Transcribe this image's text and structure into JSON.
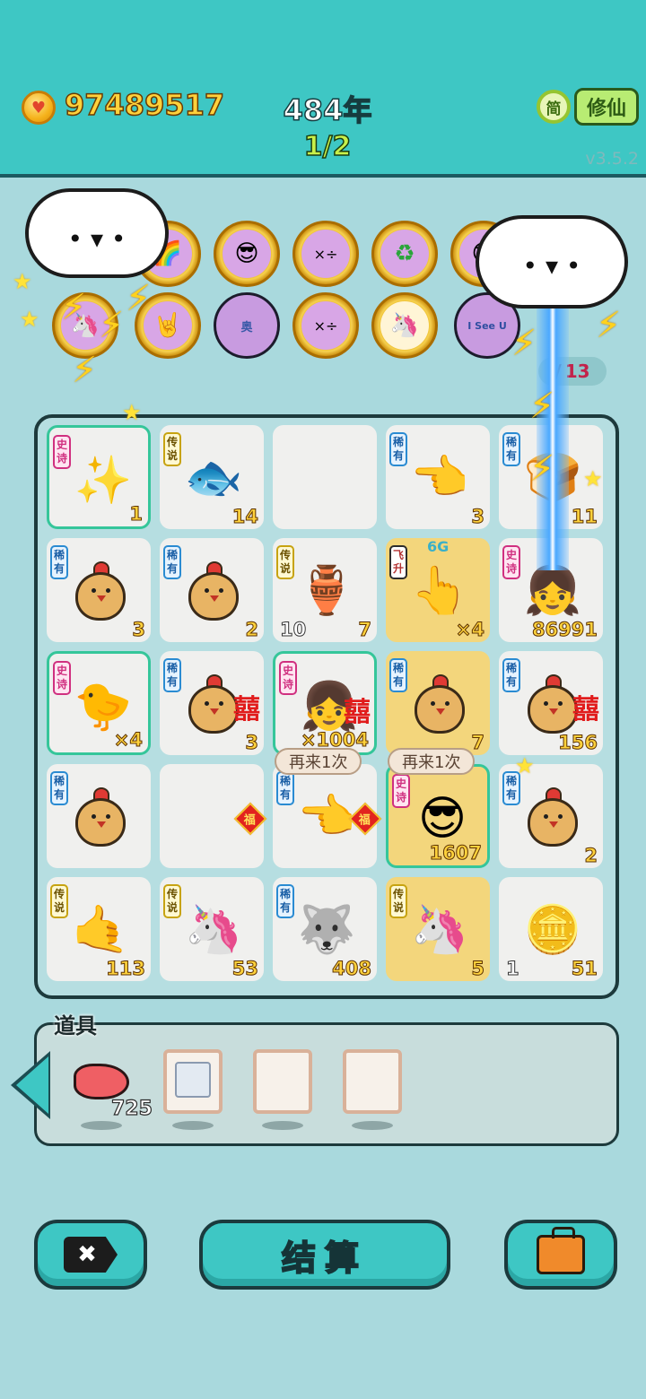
{
  "header": {
    "coins": "97489517",
    "year": "484年",
    "page": "1/2",
    "lang_label": "简",
    "mode_label": "修仙",
    "version": "v3.5.2"
  },
  "tokens": {
    "row1": [
      "rainbow-coin",
      "sunglasses-guy-coin",
      "math-coin",
      "math-coin",
      "recycle-coin",
      "sunglasses-guy-coin"
    ],
    "row2": [
      "unicorn-coin",
      "rock-hand-coin",
      "jar-coin",
      "math-coin",
      "sunglasses-guy-coin",
      "unicorn-coin",
      "i-see-u-coin"
    ],
    "jar_label": "奥",
    "isee_label": "I See U",
    "counter_sep": "/",
    "counter_total": "13"
  },
  "board": {
    "cells": [
      {
        "rarity": "史诗",
        "count": "1",
        "item": "stars"
      },
      {
        "rarity": "传说",
        "count": "14",
        "item": "koi-fish"
      },
      {
        "rarity": "",
        "count": "",
        "item": "empty"
      },
      {
        "rarity": "稀有",
        "count": "3",
        "item": "pointing-hand"
      },
      {
        "rarity": "稀有",
        "count": "11",
        "item": "bread"
      },
      {
        "rarity": "稀有",
        "count": "3",
        "item": "chick"
      },
      {
        "rarity": "稀有",
        "count": "2",
        "item": "chick"
      },
      {
        "rarity": "传说",
        "count": "7",
        "left_count": "10",
        "item": "jade-vase"
      },
      {
        "rarity": "飞升",
        "count": "×4",
        "item": "golden-hand",
        "tag": "6G"
      },
      {
        "rarity": "史诗",
        "count": "86991",
        "item": "girl"
      },
      {
        "rarity": "史诗",
        "count": "×4",
        "item": "grey-hair-chick"
      },
      {
        "rarity": "稀有",
        "count": "3",
        "item": "chick-xi"
      },
      {
        "rarity": "史诗",
        "count": "×1004",
        "item": "girl-xi"
      },
      {
        "rarity": "稀有",
        "count": "7",
        "item": "chick-crossed"
      },
      {
        "rarity": "稀有",
        "count": "156",
        "item": "chick-xi"
      },
      {
        "rarity": "稀有",
        "count": "",
        "item": "chick"
      },
      {
        "rarity": "",
        "count": "",
        "item": "fu"
      },
      {
        "rarity": "稀有",
        "count": "",
        "item": "hand-fu"
      },
      {
        "rarity": "史诗",
        "count": "1607",
        "item": "sunglasses-guy"
      },
      {
        "rarity": "稀有",
        "count": "2",
        "item": "chick"
      },
      {
        "rarity": "传说",
        "count": "113",
        "item": "gold-hand-star"
      },
      {
        "rarity": "传说",
        "count": "53",
        "item": "unicorn"
      },
      {
        "rarity": "稀有",
        "count": "408",
        "item": "husky"
      },
      {
        "rarity": "传说",
        "count": "5",
        "item": "unicorn-crossed"
      },
      {
        "rarity": "",
        "count": "51",
        "left_count": "1",
        "item": "gold-coin-stars"
      }
    ],
    "bubble_left": "再来1次",
    "bubble_right": "再来1次",
    "fu_char": "福",
    "xi_char": "囍"
  },
  "tools": {
    "label": "道具",
    "liver_count": "725"
  },
  "buttons": {
    "cancel_icon": "✖",
    "settle": "结算"
  },
  "colors": {
    "topbar": "#3ec7c4",
    "background": "#a9d9dd",
    "coin_text": "#ffd23c",
    "page_text": "#c8f04a"
  }
}
